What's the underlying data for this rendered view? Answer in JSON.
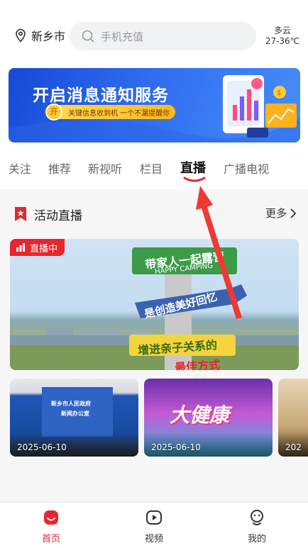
{
  "header": {
    "city": "新乡市",
    "search_placeholder": "手机充值",
    "weather_desc": "多云",
    "weather_temp": "27-36℃"
  },
  "banner": {
    "title": "开启消息通知服务",
    "subtitle": "关键信息收到机 一个不漏提醒你",
    "coin_text": "开"
  },
  "tabs": [
    {
      "label": "关注"
    },
    {
      "label": "推荐"
    },
    {
      "label": "新视听"
    },
    {
      "label": "栏目"
    },
    {
      "label": "直播"
    },
    {
      "label": "广播电视"
    }
  ],
  "active_tab": "直播",
  "section": {
    "title": "活动直播",
    "more_label": "更多"
  },
  "live_card": {
    "badge": "直播中",
    "sign_top": "带家人一起露营",
    "sign_sub": "HAPPY CAMPING",
    "sign_mid": "是创造美好回忆",
    "sign_bottom": "增进亲子关系的",
    "sign_bottom2": "最佳方式"
  },
  "thumbs": [
    {
      "date": "2025-06-10",
      "backdrop_line1": "新乡市人民政府",
      "backdrop_line2": "新闻办公室"
    },
    {
      "date": "2025-06-10",
      "title_art": "大健康"
    },
    {
      "date": "202"
    }
  ],
  "bottom_nav": [
    {
      "label": "首页",
      "icon": "home-icon"
    },
    {
      "label": "视频",
      "icon": "video-icon"
    },
    {
      "label": "我的",
      "icon": "profile-icon"
    }
  ],
  "colors": {
    "accent": "#e8262d",
    "banner_blue": "#2f6cf0"
  }
}
